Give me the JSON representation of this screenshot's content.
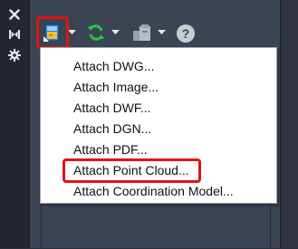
{
  "side_toolbar": {
    "icons": [
      "close-icon",
      "collapse-icon",
      "gear-icon"
    ]
  },
  "toolbar": {
    "attach_button_icon": "attach-icon",
    "refresh_button_icon": "refresh-icon",
    "paths_button_icon": "change-path-icon",
    "help_label": "?"
  },
  "menu": {
    "items": [
      {
        "label": "Attach DWG..."
      },
      {
        "label": "Attach Image..."
      },
      {
        "label": "Attach DWF..."
      },
      {
        "label": "Attach DGN..."
      },
      {
        "label": "Attach PDF..."
      },
      {
        "label": "Attach Point Cloud...",
        "highlighted": true
      },
      {
        "label": "Attach Coordination Model..."
      }
    ]
  },
  "colors": {
    "highlight": "#e01414",
    "panel": "#3b4453",
    "refresh_green": "#28c740"
  }
}
